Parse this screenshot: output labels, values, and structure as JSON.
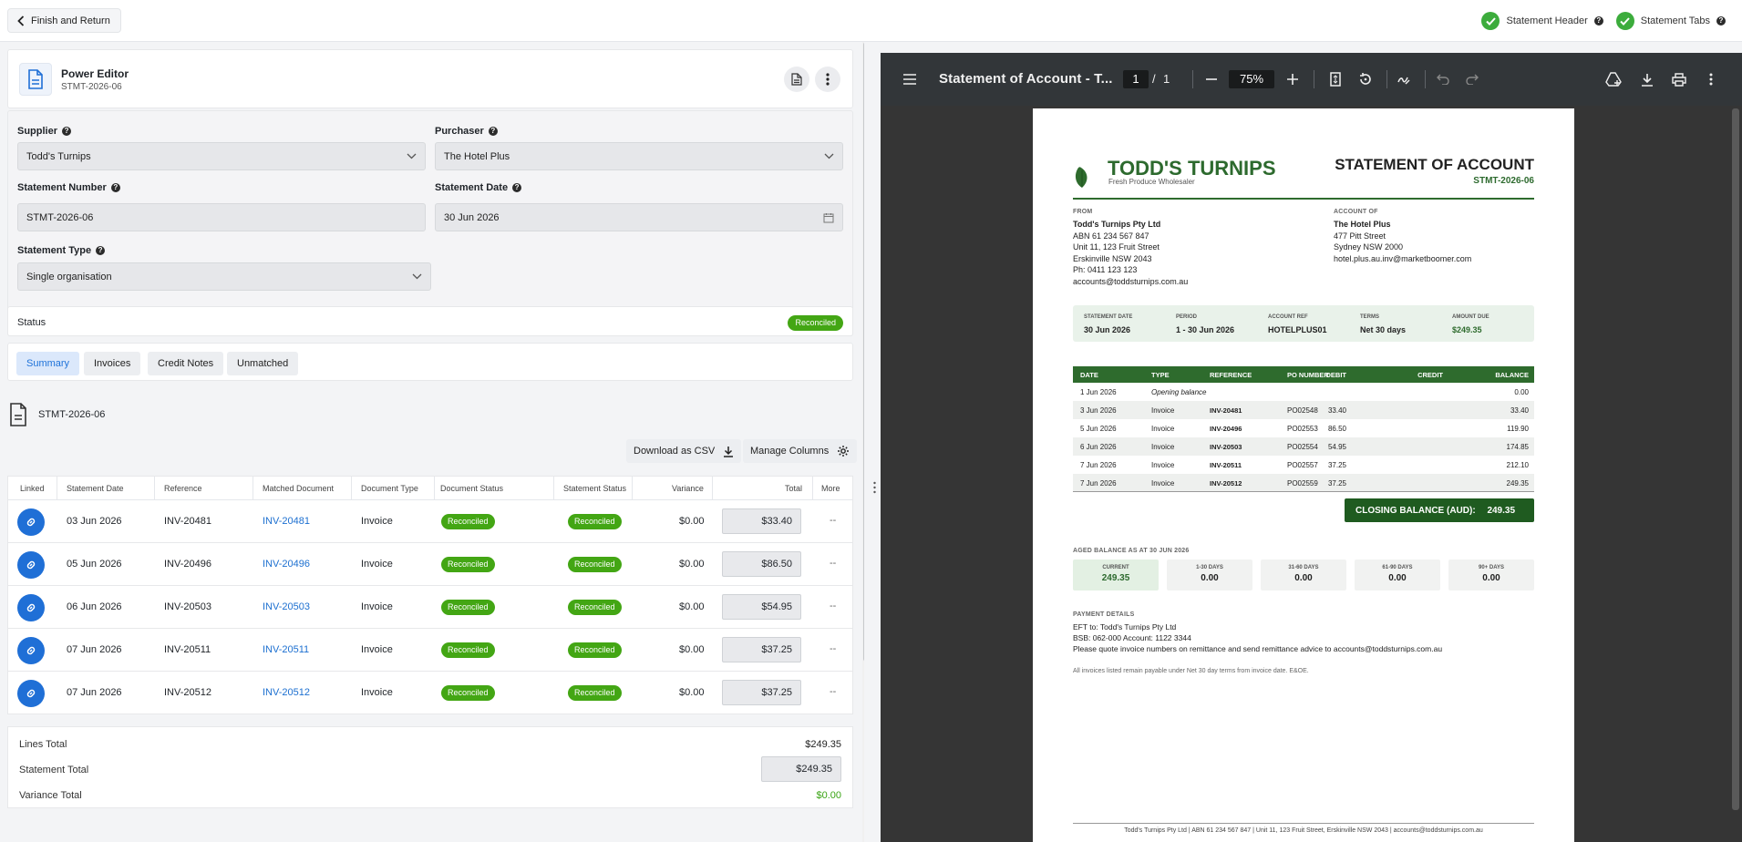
{
  "topbar": {
    "back_label": "Finish and Return",
    "checks": [
      {
        "label": "Statement Header"
      },
      {
        "label": "Statement Tabs"
      }
    ]
  },
  "editor": {
    "title": "Power Editor",
    "subtitle": "STMT-2026-06"
  },
  "form": {
    "supplier_label": "Supplier",
    "supplier_value": "Todd's Turnips",
    "purchaser_label": "Purchaser",
    "purchaser_value": "The Hotel Plus",
    "statement_number_label": "Statement Number",
    "statement_number_value": "STMT-2026-06",
    "statement_date_label": "Statement Date",
    "statement_date_value": "30 Jun 2026",
    "statement_type_label": "Statement Type",
    "statement_type_value": "Single organisation"
  },
  "status": {
    "label": "Status",
    "value": "Reconciled"
  },
  "tabs": [
    "Summary",
    "Invoices",
    "Credit Notes",
    "Unmatched"
  ],
  "doc_name": "STMT-2026-06",
  "actions": {
    "download_csv": "Download as CSV",
    "manage_columns": "Manage Columns"
  },
  "table": {
    "headers": [
      "Linked",
      "Statement Date",
      "Reference",
      "Matched Document",
      "Document Type",
      "Document Status",
      "Statement Status",
      "Variance",
      "Total",
      "More"
    ],
    "rows": [
      {
        "date": "03 Jun 2026",
        "ref": "INV-20481",
        "matched": "INV-20481",
        "type": "Invoice",
        "doc_status": "Reconciled",
        "stmt_status": "Reconciled",
        "variance": "$0.00",
        "total": "$33.40",
        "more": "--"
      },
      {
        "date": "05 Jun 2026",
        "ref": "INV-20496",
        "matched": "INV-20496",
        "type": "Invoice",
        "doc_status": "Reconciled",
        "stmt_status": "Reconciled",
        "variance": "$0.00",
        "total": "$86.50",
        "more": "--"
      },
      {
        "date": "06 Jun 2026",
        "ref": "INV-20503",
        "matched": "INV-20503",
        "type": "Invoice",
        "doc_status": "Reconciled",
        "stmt_status": "Reconciled",
        "variance": "$0.00",
        "total": "$54.95",
        "more": "--"
      },
      {
        "date": "07 Jun 2026",
        "ref": "INV-20511",
        "matched": "INV-20511",
        "type": "Invoice",
        "doc_status": "Reconciled",
        "stmt_status": "Reconciled",
        "variance": "$0.00",
        "total": "$37.25",
        "more": "--"
      },
      {
        "date": "07 Jun 2026",
        "ref": "INV-20512",
        "matched": "INV-20512",
        "type": "Invoice",
        "doc_status": "Reconciled",
        "stmt_status": "Reconciled",
        "variance": "$0.00",
        "total": "$37.25",
        "more": "--"
      }
    ]
  },
  "totals": {
    "lines_label": "Lines Total",
    "lines_value": "$249.35",
    "statement_label": "Statement Total",
    "statement_value": "$249.35",
    "variance_label": "Variance Total",
    "variance_value": "$0.00"
  },
  "viewer": {
    "title": "Statement of Account - T...",
    "page_current": "1",
    "page_sep": "/",
    "page_total": "1",
    "zoom": "75%"
  },
  "pdf": {
    "brand": "TODD'S TURNIPS",
    "tagline": "Fresh Produce Wholesaler",
    "doc_title": "STATEMENT OF ACCOUNT",
    "doc_number": "STMT-2026-06",
    "from_label": "FROM",
    "from_lines": [
      "Todd's Turnips Pty Ltd",
      "ABN 61 234 567 847",
      "Unit 11, 123 Fruit Street",
      "Erskinville NSW 2043",
      "Ph: 0411 123 123",
      "accounts@toddsturnips.com.au"
    ],
    "account_label": "ACCOUNT OF",
    "account_lines": [
      "The Hotel Plus",
      "477 Pitt Street",
      "Sydney NSW 2000",
      "hotel.plus.au.inv@marketboomer.com"
    ],
    "summary": [
      {
        "k": "STATEMENT DATE",
        "v": "30 Jun 2026"
      },
      {
        "k": "PERIOD",
        "v": "1 - 30 Jun 2026"
      },
      {
        "k": "ACCOUNT REF",
        "v": "HOTELPLUS01"
      },
      {
        "k": "TERMS",
        "v": "Net 30 days"
      },
      {
        "k": "AMOUNT DUE",
        "v": "$249.35"
      }
    ],
    "table_headers": [
      "DATE",
      "TYPE",
      "REFERENCE",
      "PO NUMBER",
      "DEBIT",
      "CREDIT",
      "BALANCE"
    ],
    "table_rows": [
      [
        "1 Jun 2026",
        "Opening balance",
        "",
        "",
        "",
        "",
        "0.00"
      ],
      [
        "3 Jun 2026",
        "Invoice",
        "INV-20481",
        "PO02548",
        "33.40",
        "",
        "33.40"
      ],
      [
        "5 Jun 2026",
        "Invoice",
        "INV-20496",
        "PO02553",
        "86.50",
        "",
        "119.90"
      ],
      [
        "6 Jun 2026",
        "Invoice",
        "INV-20503",
        "PO02554",
        "54.95",
        "",
        "174.85"
      ],
      [
        "7 Jun 2026",
        "Invoice",
        "INV-20511",
        "PO02557",
        "37.25",
        "",
        "212.10"
      ],
      [
        "7 Jun 2026",
        "Invoice",
        "INV-20512",
        "PO02559",
        "37.25",
        "",
        "249.35"
      ]
    ],
    "closing_label": "CLOSING BALANCE (AUD):",
    "closing_value": "249.35",
    "aged_title": "AGED BALANCE AS AT 30 JUN 2026",
    "aged": [
      {
        "k": "CURRENT",
        "v": "249.35"
      },
      {
        "k": "1-30 DAYS",
        "v": "0.00"
      },
      {
        "k": "31-60 DAYS",
        "v": "0.00"
      },
      {
        "k": "61-90 DAYS",
        "v": "0.00"
      },
      {
        "k": "90+ DAYS",
        "v": "0.00"
      }
    ],
    "payment_title": "PAYMENT DETAILS",
    "payment_lines": [
      "EFT to: Todd's Turnips Pty Ltd",
      "BSB: 062-000    Account: 1122 3344",
      "Please quote invoice numbers on remittance and send remittance advice to accounts@toddsturnips.com.au"
    ],
    "note": "All invoices listed remain payable under Net 30 day terms from invoice date. E&OE.",
    "footer": "Todd's Turnips Pty Ltd  |  ABN 61 234 567 847  |  Unit 11, 123 Fruit Street, Erskinville NSW 2043  |  accounts@toddsturnips.com.au"
  },
  "colors": {
    "accent": "#1f6fd6",
    "success": "#43a614",
    "brand_green": "#2d6a2e"
  }
}
